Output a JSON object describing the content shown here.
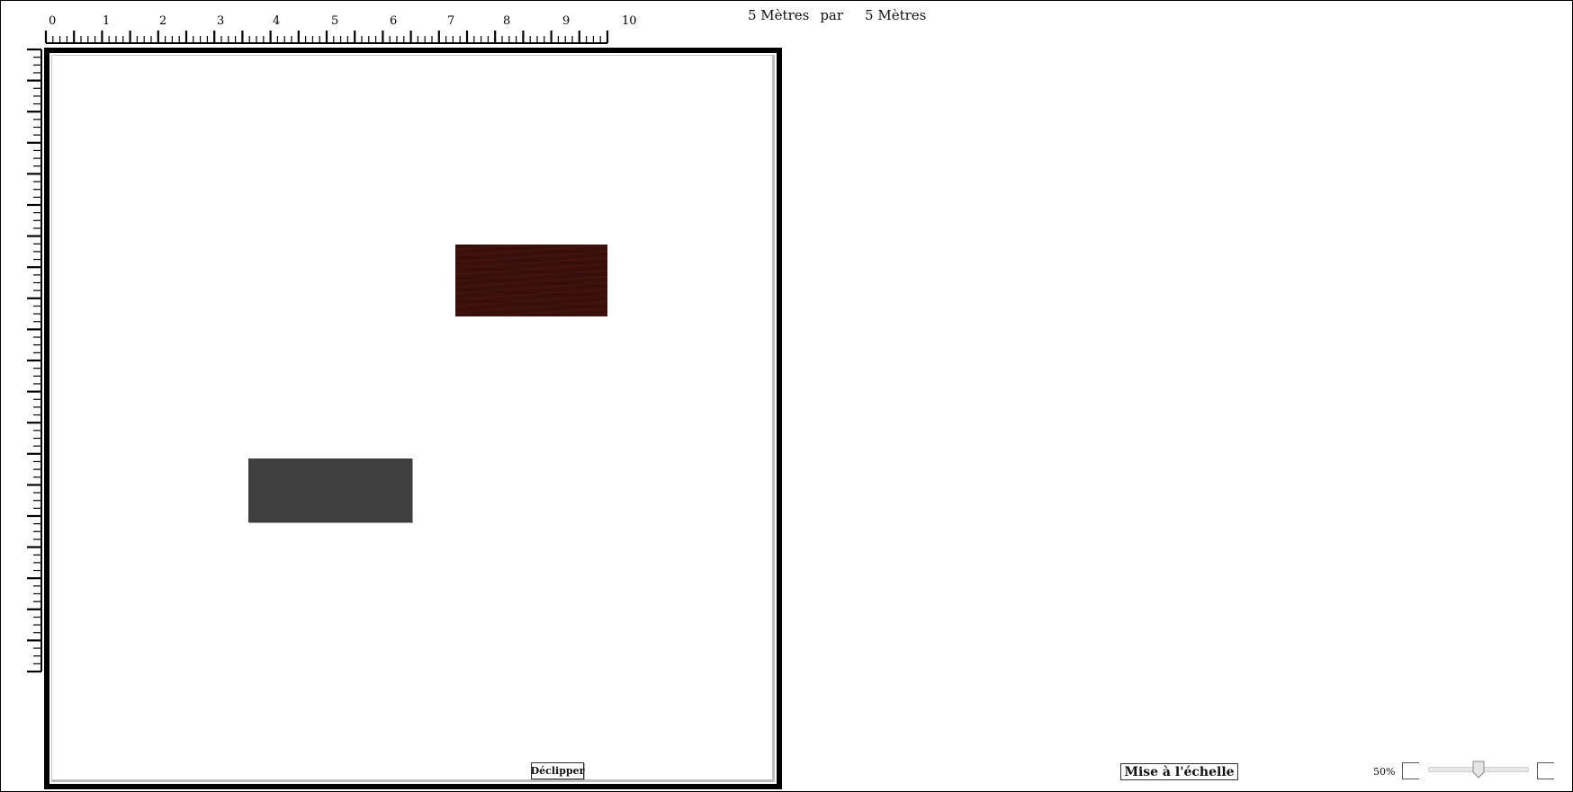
{
  "dimensions": {
    "width_text": "5 Mètres",
    "separator": "par",
    "height_text": "5 Mètres"
  },
  "ruler": {
    "horizontal_labels": [
      "0",
      "1",
      "2",
      "3",
      "4",
      "5",
      "6",
      "7",
      "8",
      "9",
      "10"
    ],
    "horizontal_minor_ticks": 81,
    "vertical_minor_ticks": 81
  },
  "canvas": {
    "items": [
      {
        "name": "wood-tile-item",
        "color": "#3a100b",
        "texture": "dark-wood"
      },
      {
        "name": "gray-tile-item",
        "color": "#3f3f3f",
        "texture": "solid"
      }
    ]
  },
  "buttons": {
    "declip_label": "Déclipper",
    "scale_label": "Mise à l'échelle"
  },
  "zoom": {
    "label": "50%",
    "value": 0.45
  }
}
